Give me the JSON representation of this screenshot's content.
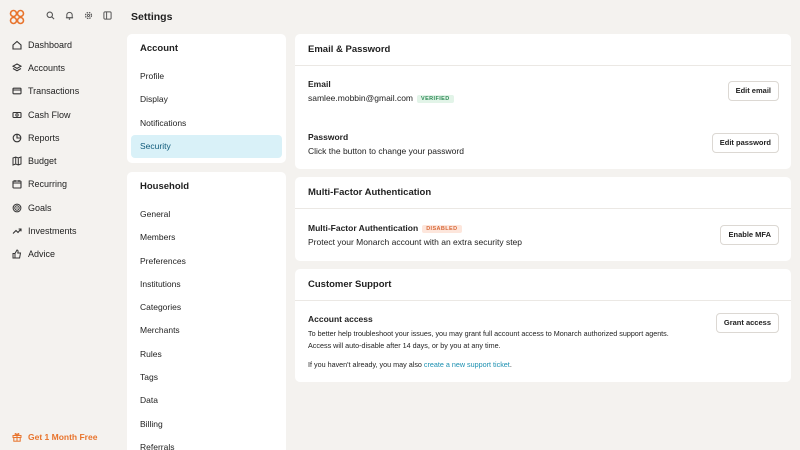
{
  "sidebar": {
    "logo": "monarch-logo",
    "top_icons": [
      "search-icon",
      "bell-icon",
      "gear-icon",
      "sidebar-toggle-icon"
    ],
    "items": [
      {
        "label": "Dashboard",
        "icon": "home-icon"
      },
      {
        "label": "Accounts",
        "icon": "layers-icon"
      },
      {
        "label": "Transactions",
        "icon": "credit-card-icon"
      },
      {
        "label": "Cash Flow",
        "icon": "cash-icon"
      },
      {
        "label": "Reports",
        "icon": "pie-chart-icon"
      },
      {
        "label": "Budget",
        "icon": "map-icon"
      },
      {
        "label": "Recurring",
        "icon": "calendar-icon"
      },
      {
        "label": "Goals",
        "icon": "target-icon"
      },
      {
        "label": "Investments",
        "icon": "trending-up-icon"
      },
      {
        "label": "Advice",
        "icon": "thumbs-up-icon"
      }
    ],
    "promo": {
      "label": "Get 1 Month Free",
      "icon": "gift-icon",
      "color": "#e8742d"
    }
  },
  "page": {
    "title": "Settings"
  },
  "settings_menu": {
    "account": {
      "heading": "Account",
      "items": [
        "Profile",
        "Display",
        "Notifications",
        "Security"
      ],
      "active": "Security"
    },
    "household": {
      "heading": "Household",
      "items": [
        "General",
        "Members",
        "Preferences",
        "Institutions",
        "Categories",
        "Merchants",
        "Rules",
        "Tags",
        "Data",
        "Billing",
        "Referrals"
      ]
    }
  },
  "email_password": {
    "heading": "Email & Password",
    "email_label": "Email",
    "email_value": "samlee.mobbin@gmail.com",
    "email_badge": "VERIFIED",
    "edit_email": "Edit email",
    "password_label": "Password",
    "password_desc": "Click the button to change your password",
    "edit_password": "Edit password"
  },
  "mfa": {
    "heading": "Multi-Factor Authentication",
    "label": "Multi-Factor Authentication",
    "badge": "DISABLED",
    "desc": "Protect your Monarch account with an extra security step",
    "button": "Enable MFA"
  },
  "support": {
    "heading": "Customer Support",
    "label": "Account access",
    "desc": "To better help troubleshoot your issues, you may grant full account access to Monarch authorized support agents. Access will auto-disable after 14 days, or by you at any time.",
    "ticket_prefix": "If you haven't already, you may also ",
    "ticket_link": "create a new support ticket",
    "ticket_suffix": ".",
    "button": "Grant access"
  },
  "colors": {
    "accent": "#e8742d",
    "active_bg": "#d9f1f8",
    "link": "#1a8fb0"
  }
}
